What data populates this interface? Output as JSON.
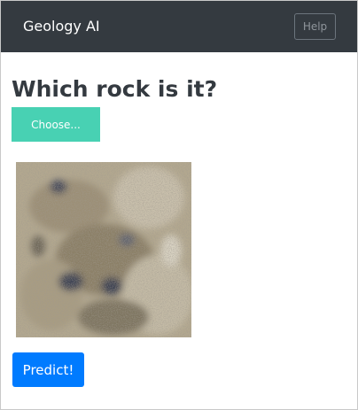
{
  "navbar": {
    "brand": "Geology AI",
    "help_label": "Help"
  },
  "main": {
    "title": "Which rock is it?",
    "choose_label": "Choose...",
    "preview_image": "rock-sample-photo",
    "predict_label": "Predict!"
  },
  "colors": {
    "navbar_bg": "#343a40",
    "choose_button": "#48d1b3",
    "predict_button": "#007bff",
    "title_text": "#343a40"
  }
}
